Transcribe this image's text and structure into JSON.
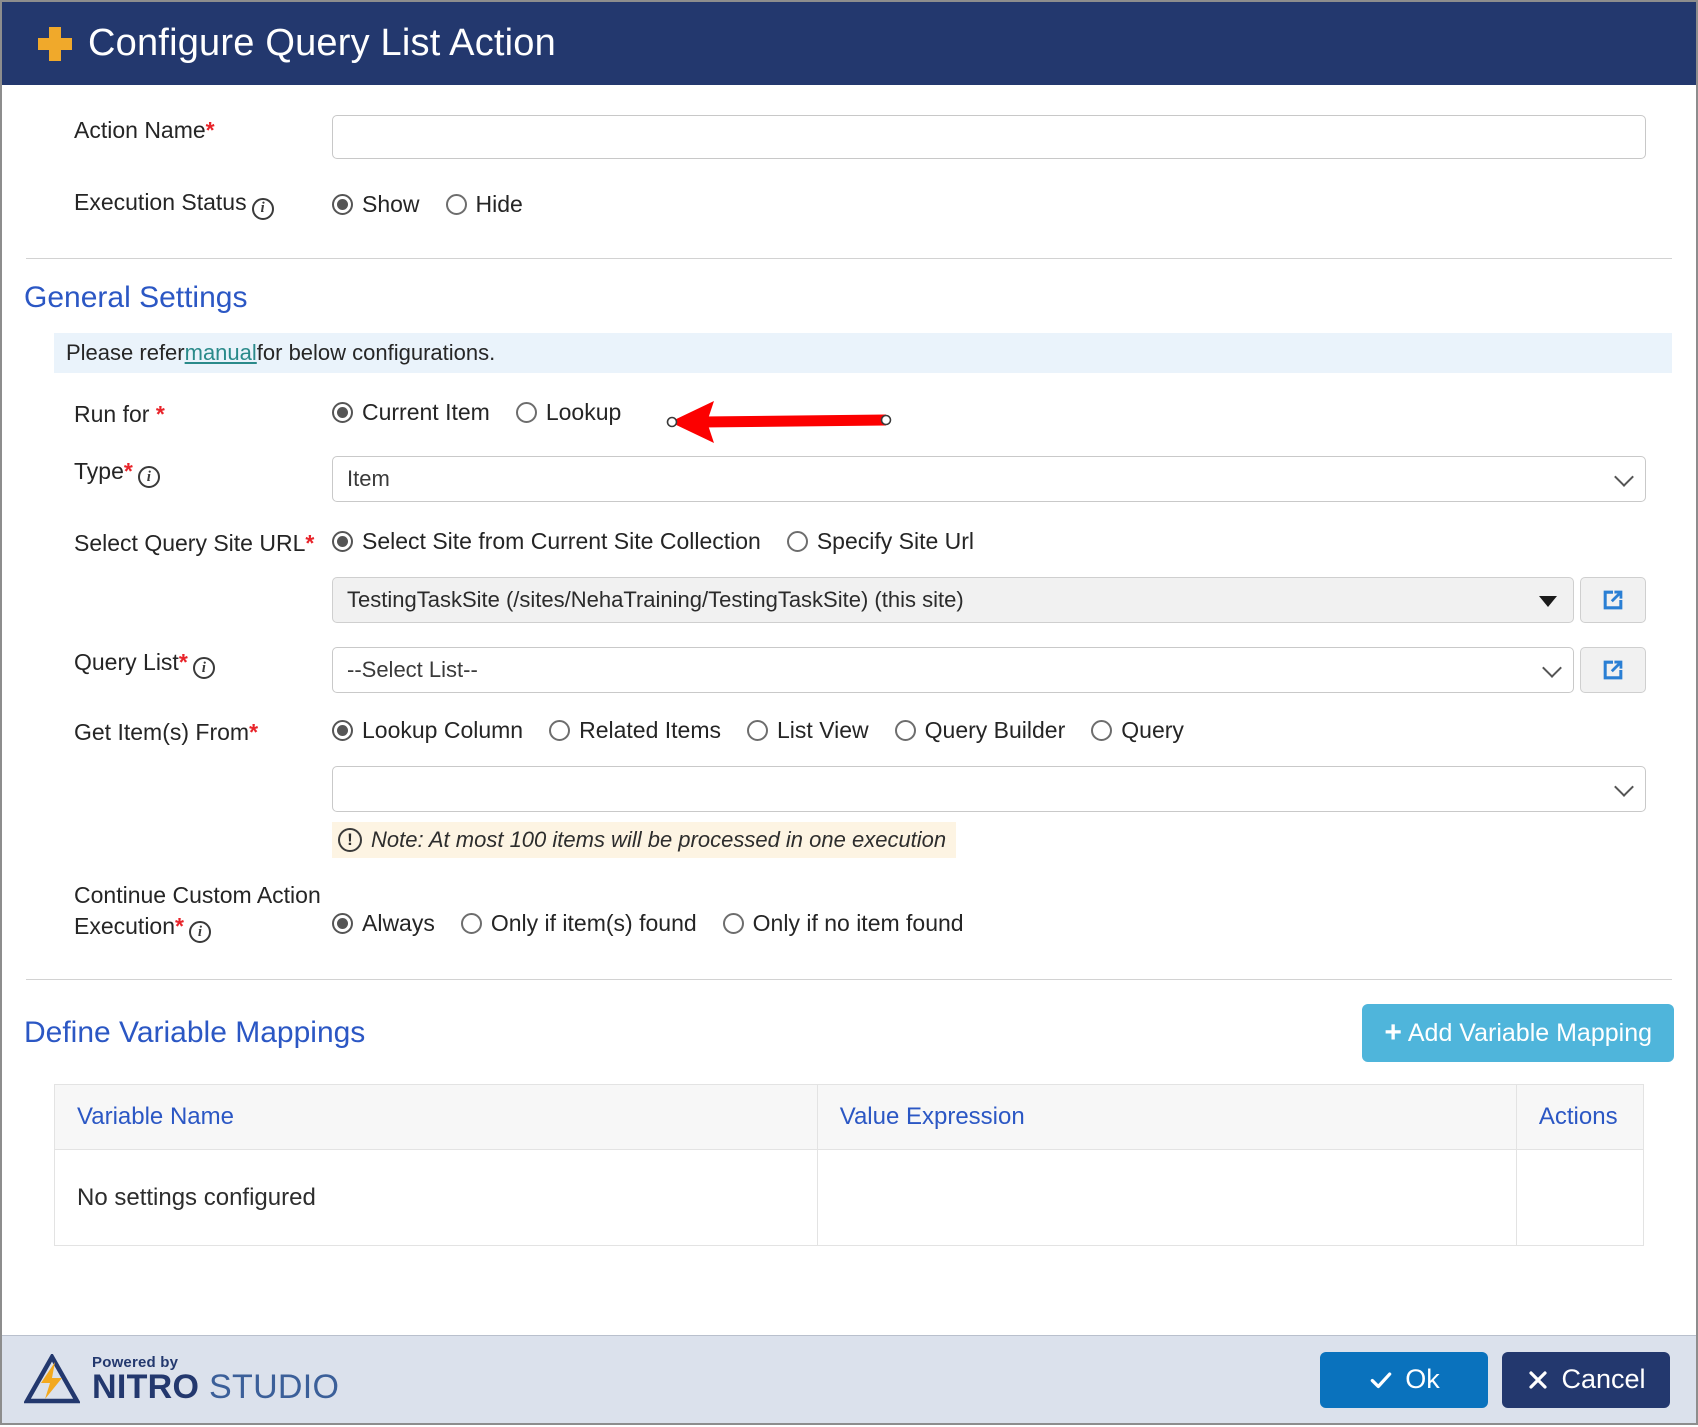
{
  "window": {
    "title": "Configure Query List Action",
    "title_icon": "plus-icon"
  },
  "form": {
    "action_name": {
      "label": "Action Name",
      "required_mark": "*",
      "value": "",
      "placeholder": ""
    },
    "execution_status": {
      "label": "Execution Status",
      "info_icon": "info-icon",
      "options": [
        "Show",
        "Hide"
      ],
      "selected": "Show"
    }
  },
  "general_settings": {
    "heading": "General Settings",
    "banner": {
      "prefix": "Please refer ",
      "link": "manual",
      "suffix": " for below configurations."
    },
    "run_for": {
      "label": "Run for ",
      "required_mark": "*",
      "options": [
        "Current Item",
        "Lookup"
      ],
      "selected": "Current Item"
    },
    "type": {
      "label": "Type",
      "required_mark": "*",
      "info_icon": "info-icon",
      "value": "Item",
      "options": [
        "Item"
      ]
    },
    "select_query_site_url": {
      "label": "Select Query Site URL",
      "required_mark": "*",
      "options": [
        "Select Site from Current Site Collection",
        "Specify Site Url"
      ],
      "selected": "Select Site from Current Site Collection",
      "site_value": "TestingTaskSite (/sites/NehaTraining/TestingTaskSite) (this site)",
      "open_icon": "external-link-icon"
    },
    "query_list": {
      "label": "Query List",
      "required_mark": "*",
      "info_icon": "info-icon",
      "value": "--Select List--",
      "open_icon": "external-link-icon"
    },
    "get_items_from": {
      "label": "Get Item(s) From",
      "required_mark": "*",
      "options": [
        "Lookup Column",
        "Related Items",
        "List View",
        "Query Builder",
        "Query"
      ],
      "selected": "Lookup Column",
      "secondary_value": "",
      "note": "Note: At most 100 items will be processed in one execution",
      "note_icon": "warning-icon"
    },
    "continue_execution": {
      "label_line1": "Continue Custom Action",
      "label_line2": "Execution",
      "required_mark": "*",
      "info_icon": "info-icon",
      "options": [
        "Always",
        "Only if item(s) found",
        "Only if no item found"
      ],
      "selected": "Always"
    }
  },
  "variable_mappings": {
    "heading": "Define Variable Mappings",
    "add_button": "Add Variable Mapping",
    "add_button_icon": "plus-icon",
    "columns": [
      "Variable Name",
      "Value Expression",
      "Actions"
    ],
    "empty_text": "No settings configured",
    "rows": []
  },
  "footer": {
    "logo": {
      "powered_by": "Powered by",
      "brand_bold": "NITRO",
      "brand_light": " STUDIO"
    },
    "ok_label": "Ok",
    "ok_icon": "check-icon",
    "cancel_label": "Cancel",
    "cancel_icon": "close-icon"
  },
  "annotation": {
    "type": "arrow",
    "color": "#fc0000",
    "points_to": "Lookup radio option"
  },
  "colors": {
    "titlebar": "#23386e",
    "accent_blue": "#2b57c4",
    "add_button": "#4fb5db",
    "ok_button": "#0a72bd",
    "cancel_button": "#23386e",
    "required": "#e8242a",
    "banner": "#eaf3fb",
    "note": "#fdf4e3",
    "annotation_red": "#fc0000",
    "plus_orange": "#f0a92b"
  }
}
